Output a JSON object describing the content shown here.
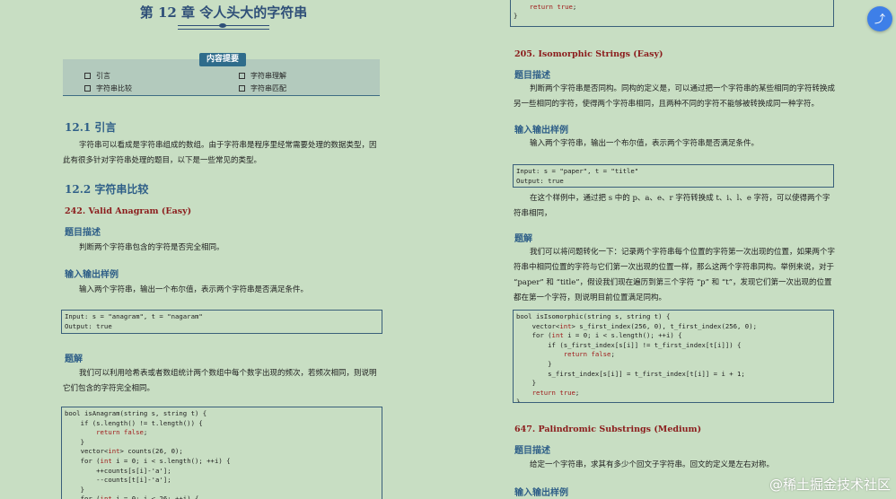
{
  "left": {
    "chapter_title": "第 12 章   令人头大的字符串",
    "summary_label": "内容提要",
    "toc": [
      "引言",
      "字符串理解",
      "字符串比较",
      "字符串匹配"
    ],
    "section_1": "12.1   引言",
    "intro_para": "字符串可以看成是字符串组成的数组。由于字符串是程序里经常需要处理的数据类型，因此有很多针对字符串处理的题目，以下是一些常见的类型。",
    "section_2": "12.2   字符串比较",
    "problem_242": "242.   Valid Anagram (Easy)",
    "desc_h": "题目描述",
    "desc_text": "判断两个字符串包含的字符是否完全相同。",
    "io_h": "输入输出样例",
    "io_text": "输入两个字符串，输出一个布尔值，表示两个字符串是否满足条件。",
    "io_code": "Input: s = \"anagram\", t = \"nagaram\"\nOutput: true",
    "sol_h": "题解",
    "sol_text": "我们可以利用哈希表或者数组统计两个数组中每个数字出现的频次，若频次相同，则说明它们包含的字符完全相同。",
    "code_lines": [
      "bool isAnagram(string s, string t) {",
      "    if (s.length() != t.length()) {",
      "        return false;",
      "    }",
      "    vector<int> counts(26, 0);",
      "    for (int i = 0; i < s.length(); ++i) {",
      "        ++counts[s[i]-'a'];",
      "        --counts[t[i]-'a'];",
      "    }",
      "    for (int i = 0; i < 26; ++i) {"
    ]
  },
  "right": {
    "top_code_lines": [
      "    }",
      "    return true;",
      "}"
    ],
    "problem_205": "205.   Isomorphic Strings (Easy)",
    "desc_h": "题目描述",
    "desc_text": "判断两个字符串是否同构。同构的定义是，可以通过把一个字符串的某些相同的字符转换成另一些相同的字符，使得两个字符串相同，且两种不同的字符不能够被转换成同一种字符。",
    "io_h": "输入输出样例",
    "io_text": "输入两个字符串，输出一个布尔值，表示两个字符串是否满足条件。",
    "io_code": "Input: s = \"paper\", t = \"title\"\nOutput: true",
    "example_text": "在这个样例中，通过把 s 中的 p、a、e、r 字符转换成 t、i、l、e 字符，可以使得两个字符串相同，",
    "sol_h": "题解",
    "sol_text": "我们可以将问题转化一下：记录两个字符串每个位置的字符第一次出现的位置，如果两个字符串中相同位置的字符与它们第一次出现的位置一样，那么这两个字符串同构。举例来说，对于 “paper” 和 “title”，假设我们现在遍历到第三个字符 “p” 和 “t”，发现它们第一次出现的位置都在第一个字符，则说明目前位置满足同构。",
    "code_lines": [
      "bool isIsomorphic(string s, string t) {",
      "    vector<int> s_first_index(256, 0), t_first_index(256, 0);",
      "    for (int i = 0; i < s.length(); ++i) {",
      "        if (s_first_index[s[i]] != t_first_index[t[i]]) {",
      "            return false;",
      "        }",
      "        s_first_index[s[i]] = t_first_index[t[i]] = i + 1;",
      "    }",
      "    return true;",
      "}"
    ],
    "problem_647": "647.   Palindromic Substrings (Medium)",
    "desc2_h": "题目描述",
    "desc2_text": "给定一个字符串，求其有多少个回文子字符串。回文的定义是左右对称。",
    "io2_h": "输入输出样例"
  },
  "overlay": {
    "sidebar_icon": "⤴",
    "watermark": "@稀土掘金技术社区"
  }
}
